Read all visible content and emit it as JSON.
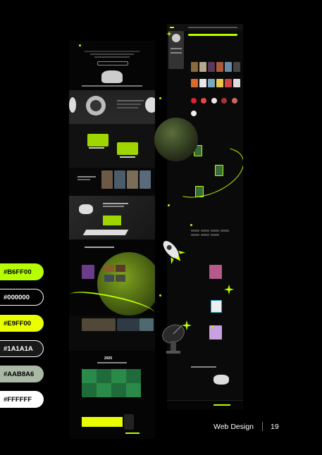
{
  "palette": [
    {
      "hex": "#B6FF00",
      "label": "#B6FF00"
    },
    {
      "hex": "#000000",
      "label": "#000000"
    },
    {
      "hex": "#E9FF00",
      "label": "#E9FF00"
    },
    {
      "hex": "#1A1A1A",
      "label": "#1A1A1A"
    },
    {
      "hex": "#AAB8A6",
      "label": "#AAB8A6"
    },
    {
      "hex": "#FFFFFF",
      "label": "#FFFFFF"
    }
  ],
  "footer": {
    "section_label": "Web Design",
    "page_number": "19"
  },
  "mock_left": {
    "year_heading": "2025"
  },
  "colors": {
    "accent": "#B6FF00",
    "background": "#000000",
    "panel": "#1A1A1A"
  }
}
